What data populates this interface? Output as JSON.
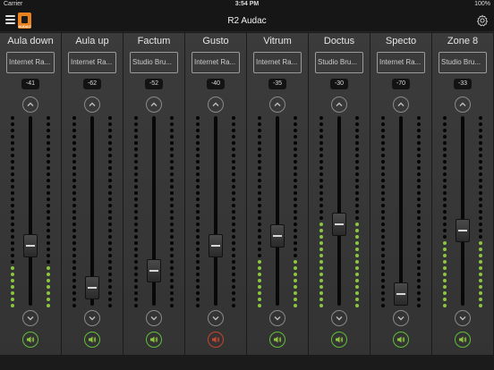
{
  "status": {
    "carrier": "Carrier",
    "time": "3:54 PM",
    "battery": "100%"
  },
  "app": {
    "title": "R2 Audac",
    "logo_text": "AUDAC"
  },
  "channels": [
    {
      "name": "Aula down",
      "source": "Internet Ra...",
      "db": "-41",
      "level": 0.21,
      "fader": 0.29,
      "muted": false
    },
    {
      "name": "Aula up",
      "source": "Internet Ra...",
      "db": "-62",
      "level": 0.0,
      "fader": 0.04,
      "muted": false
    },
    {
      "name": "Factum",
      "source": "Studio Bru...",
      "db": "-52",
      "level": 0.0,
      "fader": 0.14,
      "muted": false
    },
    {
      "name": "Gusto",
      "source": "Internet Ra...",
      "db": "-40",
      "level": 0.0,
      "fader": 0.29,
      "muted": true
    },
    {
      "name": "Vitrum",
      "source": "Internet Ra...",
      "db": "-35",
      "level": 0.27,
      "fader": 0.35,
      "muted": false
    },
    {
      "name": "Doctus",
      "source": "Studio Bru...",
      "db": "-30",
      "level": 0.44,
      "fader": 0.42,
      "muted": false
    },
    {
      "name": "Specto",
      "source": "Internet Ra...",
      "db": "-70",
      "level": 0.0,
      "fader": 0.0,
      "muted": false
    },
    {
      "name": "Zone 8",
      "source": "Studio Bru...",
      "db": "-33",
      "level": 0.37,
      "fader": 0.38,
      "muted": false
    }
  ],
  "colors": {
    "accent_green": "#8cc63f",
    "mute_red": "#c9432e",
    "logo_orange": "#e8821f"
  },
  "icons": {
    "menu": "menu-icon",
    "settings": "gear-icon",
    "up": "chevron-up-icon",
    "down": "chevron-down-icon",
    "speaker": "speaker-icon"
  }
}
